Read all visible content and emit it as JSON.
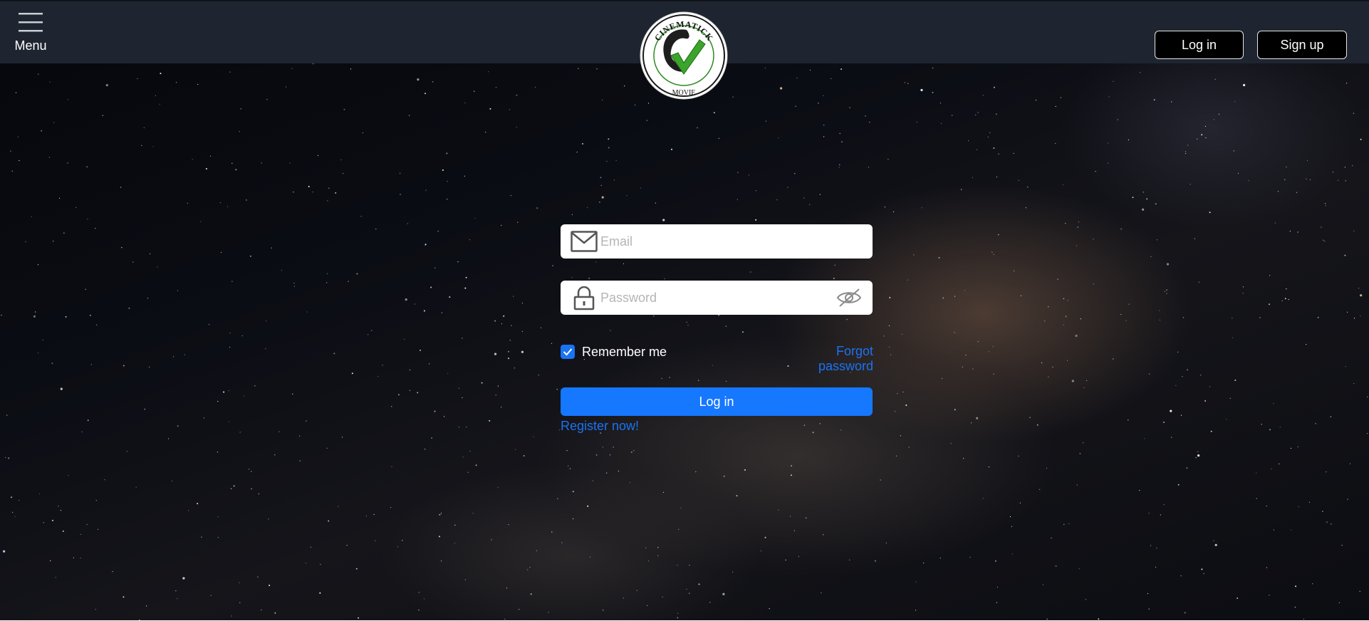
{
  "header": {
    "menu_label": "Menu",
    "menu_icon": "hamburger-icon",
    "logo": {
      "top_text": "CINEMATICK",
      "bottom_text": "MOVIE",
      "icon": "checkmark-logo"
    },
    "login_label": "Log in",
    "signup_label": "Sign up"
  },
  "form": {
    "email": {
      "placeholder": "Email",
      "value": "",
      "icon": "envelope-icon"
    },
    "password": {
      "placeholder": "Password",
      "value": "",
      "icon": "lock-icon",
      "toggle_icon": "eye-slash-icon"
    },
    "remember_label": "Remember me",
    "remember_checked": true,
    "forgot_label": "Forgot password",
    "submit_label": "Log in",
    "register_label": "Register now!"
  },
  "colors": {
    "header_bg": "#1f2530",
    "accent": "#1677ff",
    "link": "#1a73f2",
    "logo_green": "#2e8b23"
  }
}
